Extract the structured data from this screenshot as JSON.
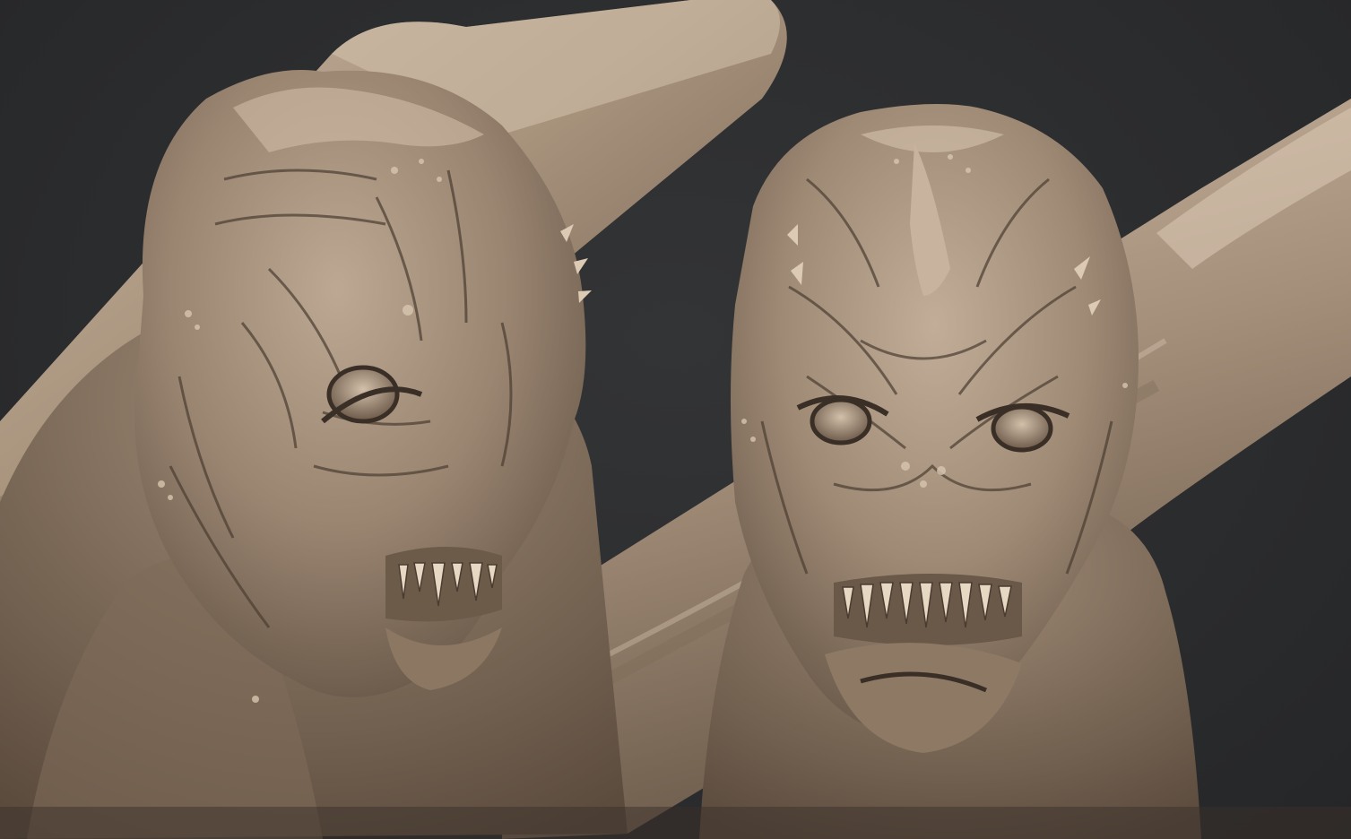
{
  "scene": {
    "subject": "sculpted-creature-heads",
    "views": [
      "three-quarter-view",
      "front-view"
    ],
    "colors": {
      "background": "#2b2c2e",
      "clay_base": "#8e7a66",
      "clay_light": "#c9b6a0",
      "clay_highlight": "#e3d3bf",
      "clay_shadow": "#4a3d31",
      "crease": "#3a2f26"
    }
  }
}
